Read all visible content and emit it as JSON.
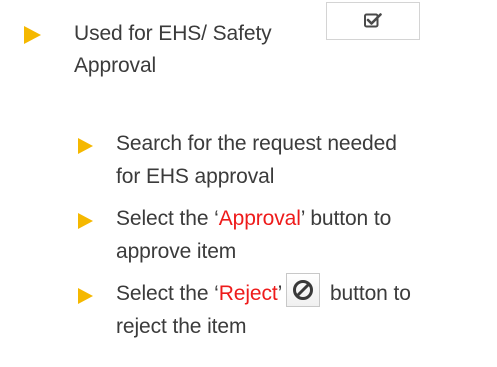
{
  "top": {
    "heading_line1": "Used for EHS/ Safety",
    "heading_line2": "Approval"
  },
  "steps": [
    {
      "line1": "Search for the request needed",
      "line2": "for EHS approval"
    },
    {
      "line1_prefix": "Select the ‘",
      "line1_highlight": "Approval",
      "line1_suffix": "’ button to",
      "line2": "approve item"
    },
    {
      "line1_prefix": "Select the ‘",
      "line1_highlight": "Reject",
      "line1_suffix_a": "’",
      "line1_suffix_b": " button to",
      "line2": "reject the item"
    }
  ],
  "icons": {
    "approval": "checkbox-check-icon",
    "reject": "prohibit-icon"
  },
  "colors": {
    "bullet": "#f5b800",
    "highlight": "#ee1b1b",
    "text": "#3b3b3b"
  }
}
